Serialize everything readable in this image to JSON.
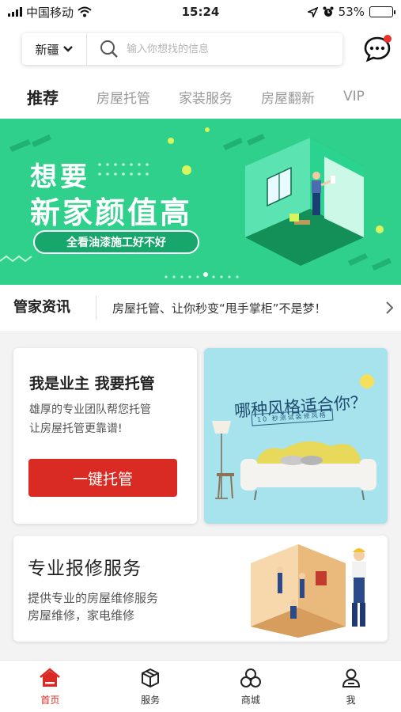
{
  "status_bar": {
    "carrier": "中国移动",
    "time": "15:24",
    "battery": "53%",
    "battery_level": 0.53,
    "icons": [
      "signal-icon",
      "wifi-icon",
      "location-icon",
      "alarm-icon",
      "battery-icon"
    ]
  },
  "search": {
    "city": "新疆",
    "placeholder": "输入你想找的信息",
    "icon": "search-icon",
    "message_icon": "chat-bubble-icon"
  },
  "tabs": [
    {
      "label": "推荐"
    },
    {
      "label": "房屋托管"
    },
    {
      "label": "家装服务"
    },
    {
      "label": "房屋翻新"
    },
    {
      "label": "VIP"
    }
  ],
  "banner": {
    "line1": "想要",
    "line2": "新家颜值高",
    "pill": "全看油漆施工好不好"
  },
  "news": {
    "label": "管家资讯",
    "text": "房屋托管、让你秒变“甩手掌柜”不是梦！"
  },
  "owner_card": {
    "title": "我是业主 我要托管",
    "desc_line1": "雄厚的专业团队帮您托管",
    "desc_line2": "让房屋托管更靠谱!",
    "button": "一键托管"
  },
  "style_card": {
    "title": "哪种风格适合你？",
    "subtitle": "10 秒测试装修风格"
  },
  "repair_card": {
    "title": "专业报修服务",
    "desc_line1": "提供专业的房屋维修服务",
    "desc_line2": "房屋维修，家电维修"
  },
  "bottom_nav": [
    {
      "label": "首页",
      "icon": "home-icon",
      "active": true
    },
    {
      "label": "服务",
      "icon": "box-icon",
      "active": false
    },
    {
      "label": "商城",
      "icon": "mall-icon",
      "active": false
    },
    {
      "label": "我",
      "icon": "user-icon",
      "active": false
    }
  ],
  "colors": {
    "accent_red": "#d92b23",
    "banner_green": "#2fcf8c",
    "style_card_bg": "#a6e3ec"
  }
}
